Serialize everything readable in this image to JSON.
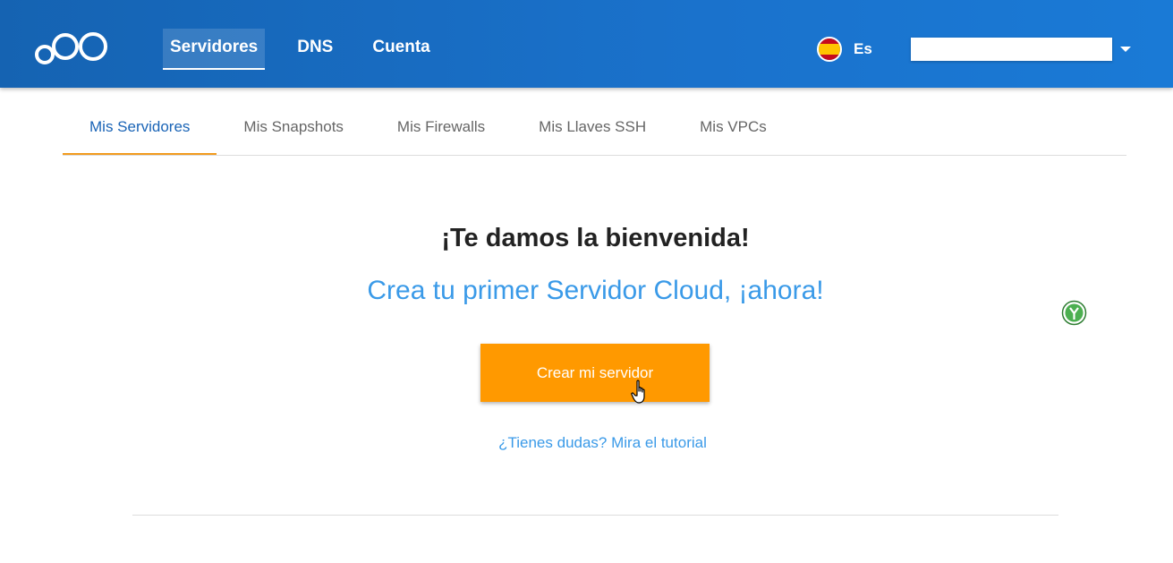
{
  "header": {
    "nav": [
      {
        "label": "Servidores",
        "active": true
      },
      {
        "label": "DNS",
        "active": false
      },
      {
        "label": "Cuenta",
        "active": false
      }
    ],
    "language": {
      "label": "Es",
      "icon": "spain-flag-icon"
    },
    "user_field_value": "",
    "colors": {
      "bar": "#1a72cc"
    }
  },
  "tabs": [
    {
      "label": "Mis Servidores",
      "active": true
    },
    {
      "label": "Mis Snapshots",
      "active": false
    },
    {
      "label": "Mis Firewalls",
      "active": false
    },
    {
      "label": "Mis Llaves SSH",
      "active": false
    },
    {
      "label": "Mis VPCs",
      "active": false
    }
  ],
  "main": {
    "title": "¡Te damos la bienvenida!",
    "subtitle": "Crea tu primer Servidor Cloud, ¡ahora!",
    "cta_label": "Crear mi servidor",
    "tutorial_link": "¿Tienes dudas? Mira el tutorial"
  },
  "colors": {
    "accent": "#ff9900",
    "link": "#3a9ae8",
    "active_tab": "#1a64b6",
    "tab_underline": "#f29b1e"
  }
}
